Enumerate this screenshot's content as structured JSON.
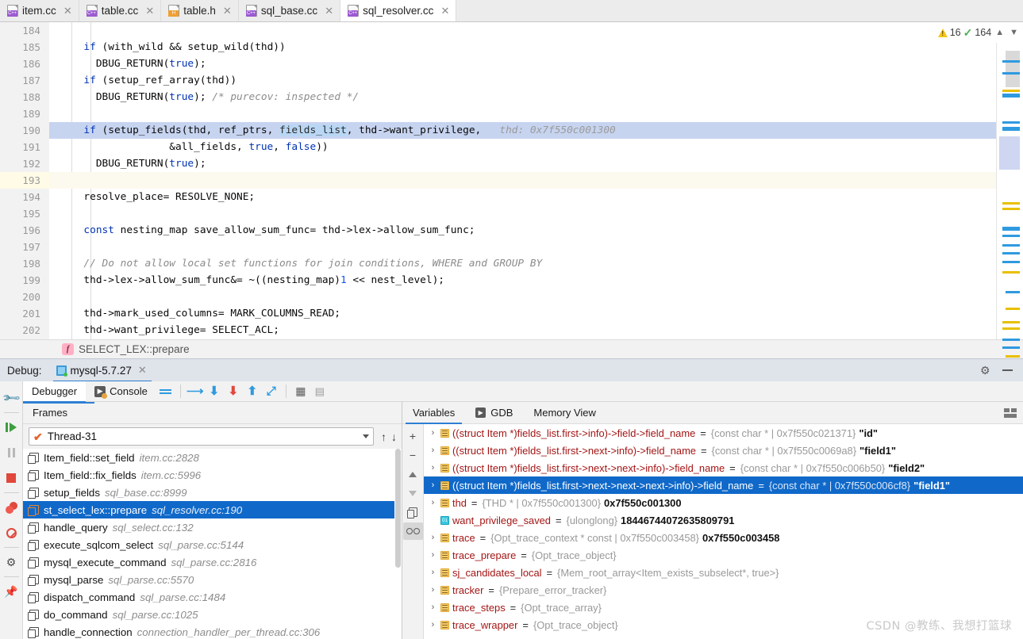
{
  "tabs": [
    {
      "label": "item.cc",
      "lang": "C++",
      "active": false
    },
    {
      "label": "table.cc",
      "lang": "C++",
      "active": false
    },
    {
      "label": "table.h",
      "lang": "H",
      "active": false
    },
    {
      "label": "sql_base.cc",
      "lang": "C++",
      "active": false
    },
    {
      "label": "sql_resolver.cc",
      "lang": "C++",
      "active": true
    }
  ],
  "editor": {
    "warnings_count": "16",
    "checks_count": "164",
    "lines": [
      {
        "n": "184",
        "segments": []
      },
      {
        "n": "185",
        "segments": [
          {
            "t": "  ",
            "c": "txt"
          },
          {
            "t": "if",
            "c": "kw"
          },
          {
            "t": " (with_wild && setup_wild(thd))",
            "c": "txt"
          }
        ]
      },
      {
        "n": "186",
        "segments": [
          {
            "t": "    DBUG_RETURN(",
            "c": "txt"
          },
          {
            "t": "true",
            "c": "kw"
          },
          {
            "t": ");",
            "c": "txt"
          }
        ]
      },
      {
        "n": "187",
        "segments": [
          {
            "t": "  ",
            "c": "txt"
          },
          {
            "t": "if",
            "c": "kw"
          },
          {
            "t": " (setup_ref_array(thd))",
            "c": "txt"
          }
        ]
      },
      {
        "n": "188",
        "segments": [
          {
            "t": "    DBUG_RETURN(",
            "c": "txt"
          },
          {
            "t": "true",
            "c": "kw"
          },
          {
            "t": "); ",
            "c": "txt"
          },
          {
            "t": "/* purecov: inspected */",
            "c": "cmt"
          }
        ]
      },
      {
        "n": "189",
        "segments": []
      },
      {
        "n": "190",
        "selected": true,
        "segments": [
          {
            "t": "  ",
            "c": "txt"
          },
          {
            "t": "if",
            "c": "kw"
          },
          {
            "t": " (setup_fields(thd, ref_ptrs, ",
            "c": "txt"
          },
          {
            "t": "fields_list",
            "c": "ident-hl"
          },
          {
            "t": ", thd->want_privilege,   ",
            "c": "txt"
          },
          {
            "t": "thd: 0x7f550c001300",
            "c": "hint"
          }
        ]
      },
      {
        "n": "191",
        "segments": [
          {
            "t": "                &all_fields, ",
            "c": "txt"
          },
          {
            "t": "true",
            "c": "kw"
          },
          {
            "t": ", ",
            "c": "txt"
          },
          {
            "t": "false",
            "c": "kw"
          },
          {
            "t": "))",
            "c": "txt"
          }
        ]
      },
      {
        "n": "192",
        "segments": [
          {
            "t": "    DBUG_RETURN(",
            "c": "txt"
          },
          {
            "t": "true",
            "c": "kw"
          },
          {
            "t": ");",
            "c": "txt"
          }
        ]
      },
      {
        "n": "193",
        "warn": true,
        "segments": []
      },
      {
        "n": "194",
        "segments": [
          {
            "t": "  resolve_place= RESOLVE_NONE;",
            "c": "txt"
          }
        ]
      },
      {
        "n": "195",
        "segments": []
      },
      {
        "n": "196",
        "segments": [
          {
            "t": "  ",
            "c": "txt"
          },
          {
            "t": "const",
            "c": "kw"
          },
          {
            "t": " nesting_map save_allow_sum_func= thd->lex->allow_sum_func;",
            "c": "txt"
          }
        ]
      },
      {
        "n": "197",
        "segments": []
      },
      {
        "n": "198",
        "segments": [
          {
            "t": "  ",
            "c": "txt"
          },
          {
            "t": "// Do not allow local set functions for join conditions, WHERE and GROUP BY",
            "c": "cmt"
          }
        ]
      },
      {
        "n": "199",
        "segments": [
          {
            "t": "  thd->lex->allow_sum_func&= ~((nesting_map)",
            "c": "txt"
          },
          {
            "t": "1",
            "c": "num"
          },
          {
            "t": " << nest_level);",
            "c": "txt"
          }
        ]
      },
      {
        "n": "200",
        "segments": []
      },
      {
        "n": "201",
        "segments": [
          {
            "t": "  thd->mark_used_columns= MARK_COLUMNS_READ;",
            "c": "txt"
          }
        ]
      },
      {
        "n": "202",
        "segments": [
          {
            "t": "  thd->want_privilege= SELECT_ACL;",
            "c": "txt"
          }
        ]
      }
    ]
  },
  "breadcrumb": {
    "icon_letter": "f",
    "text": "SELECT_LEX::prepare"
  },
  "debug": {
    "label": "Debug:",
    "session_tab": "mysql-5.7.27",
    "toolbar_tabs": [
      {
        "label": "Debugger",
        "active": true
      },
      {
        "label": "Console",
        "active": false
      }
    ],
    "frames": {
      "header": "Frames",
      "thread": "Thread-31",
      "items": [
        {
          "fn": "Item_field::set_field",
          "loc": "item.cc:2828",
          "selected": false
        },
        {
          "fn": "Item_field::fix_fields",
          "loc": "item.cc:5996",
          "selected": false
        },
        {
          "fn": "setup_fields",
          "loc": "sql_base.cc:8999",
          "selected": false
        },
        {
          "fn": "st_select_lex::prepare",
          "loc": "sql_resolver.cc:190",
          "selected": true
        },
        {
          "fn": "handle_query",
          "loc": "sql_select.cc:132",
          "selected": false
        },
        {
          "fn": "execute_sqlcom_select",
          "loc": "sql_parse.cc:5144",
          "selected": false
        },
        {
          "fn": "mysql_execute_command",
          "loc": "sql_parse.cc:2816",
          "selected": false
        },
        {
          "fn": "mysql_parse",
          "loc": "sql_parse.cc:5570",
          "selected": false
        },
        {
          "fn": "dispatch_command",
          "loc": "sql_parse.cc:1484",
          "selected": false
        },
        {
          "fn": "do_command",
          "loc": "sql_parse.cc:1025",
          "selected": false
        },
        {
          "fn": "handle_connection",
          "loc": "connection_handler_per_thread.cc:306",
          "selected": false
        }
      ]
    },
    "variables": {
      "tabs": [
        {
          "label": "Variables",
          "active": true
        },
        {
          "label": "GDB",
          "active": false
        },
        {
          "label": "Memory View",
          "active": false
        }
      ],
      "items": [
        {
          "expandable": true,
          "icon": "struct",
          "name": "((struct Item *)fields_list.first->info)->field->field_name",
          "type": "{const char * | 0x7f550c021371}",
          "value": "\"id\"",
          "selected": false
        },
        {
          "expandable": true,
          "icon": "struct",
          "name": "((struct Item *)fields_list.first->next->info)->field_name",
          "type": "{const char * | 0x7f550c0069a8}",
          "value": "\"field1\"",
          "selected": false
        },
        {
          "expandable": true,
          "icon": "struct",
          "name": "((struct Item *)fields_list.first->next->next->info)->field_name",
          "type": "{const char * | 0x7f550c006b50}",
          "value": "\"field2\"",
          "selected": false
        },
        {
          "expandable": true,
          "icon": "struct",
          "name": "((struct Item *)fields_list.first->next->next->next->info)->field_name",
          "type": "{const char * | 0x7f550c006cf8}",
          "value": "\"field1\"",
          "selected": true
        },
        {
          "expandable": true,
          "icon": "struct",
          "name": "thd",
          "type": "{THD * | 0x7f550c001300}",
          "value": "0x7f550c001300",
          "selected": false
        },
        {
          "expandable": false,
          "icon": "num01",
          "name": "want_privilege_saved",
          "type": "{ulonglong}",
          "value": "18446744072635809791",
          "selected": false
        },
        {
          "expandable": true,
          "icon": "struct",
          "name": "trace",
          "type": "{Opt_trace_context * const | 0x7f550c003458}",
          "value": "0x7f550c003458",
          "selected": false
        },
        {
          "expandable": true,
          "icon": "struct",
          "name": "trace_prepare",
          "type": "{Opt_trace_object}",
          "value": "",
          "selected": false
        },
        {
          "expandable": true,
          "icon": "struct",
          "name": "sj_candidates_local",
          "type": "{Mem_root_array<Item_exists_subselect*, true>}",
          "value": "",
          "selected": false
        },
        {
          "expandable": true,
          "icon": "struct",
          "name": "tracker",
          "type": "{Prepare_error_tracker}",
          "value": "",
          "selected": false
        },
        {
          "expandable": true,
          "icon": "struct",
          "name": "trace_steps",
          "type": "{Opt_trace_array}",
          "value": "",
          "selected": false
        },
        {
          "expandable": true,
          "icon": "struct",
          "name": "trace_wrapper",
          "type": "{Opt_trace_object}",
          "value": "",
          "selected": false
        }
      ]
    }
  },
  "watermark": "CSDN @教练、我想打篮球",
  "colors": {
    "accent": "#2d7fd3",
    "selection_blue": "#1069c9",
    "code_selection": "#c7d4f0",
    "warn_yellow": "#f5c518",
    "ok_green": "#4caf50",
    "var_name_red": "#a31515"
  }
}
